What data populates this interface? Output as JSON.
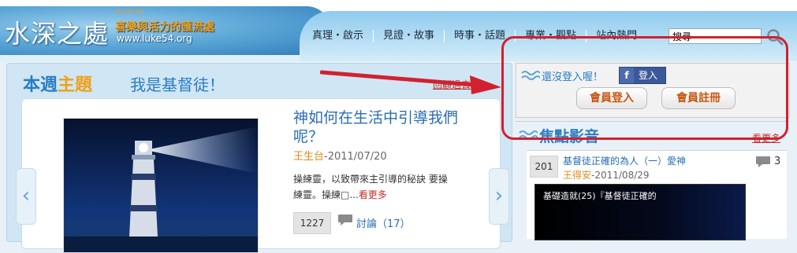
{
  "site": {
    "title": "水深之處",
    "slogan": "喜樂與活力的匯流處",
    "url": "www.luke54.org",
    "decor": "✂✂✂"
  },
  "nav": {
    "items": [
      {
        "label": "真理・啟示"
      },
      {
        "label": "見證・故事"
      },
      {
        "label": "時事・話題"
      },
      {
        "label": "專業・觀點"
      },
      {
        "label": "站內熱門"
      }
    ],
    "search_value": "搜尋"
  },
  "theme": {
    "title_pre": "本週",
    "title_hl": "主題",
    "subtitle": "我是基督徒！",
    "review_link": "回顧過去"
  },
  "article": {
    "title": "神如何在生活中引導我們呢？",
    "author": "王生台",
    "date": "-2011/07/20",
    "excerpt": "操練靈，以致帶來主引導的秘訣 要操練靈。操練□...",
    "more": "看更多",
    "views": "1227",
    "comments": "討論（17）",
    "prev_arrow": "‹",
    "next_arrow": "›"
  },
  "login": {
    "prompt": "還沒登入喔！",
    "fb_label": "登入",
    "fb_letter": "f",
    "member_login": "會員登入",
    "member_register": "會員註冊"
  },
  "media": {
    "title": "焦點影音",
    "more": "看更多",
    "item": {
      "count": "201",
      "title": "基督徒正確的為人（一）愛神",
      "author": "王得安",
      "date": "-2011/08/29",
      "comments": "3",
      "caption": "基礎造就(25)『基督徒正確的"
    }
  },
  "colors": {
    "accent_blue": "#2a7dc4",
    "accent_orange": "#f0a01a",
    "annotation_red": "#d3202f"
  }
}
